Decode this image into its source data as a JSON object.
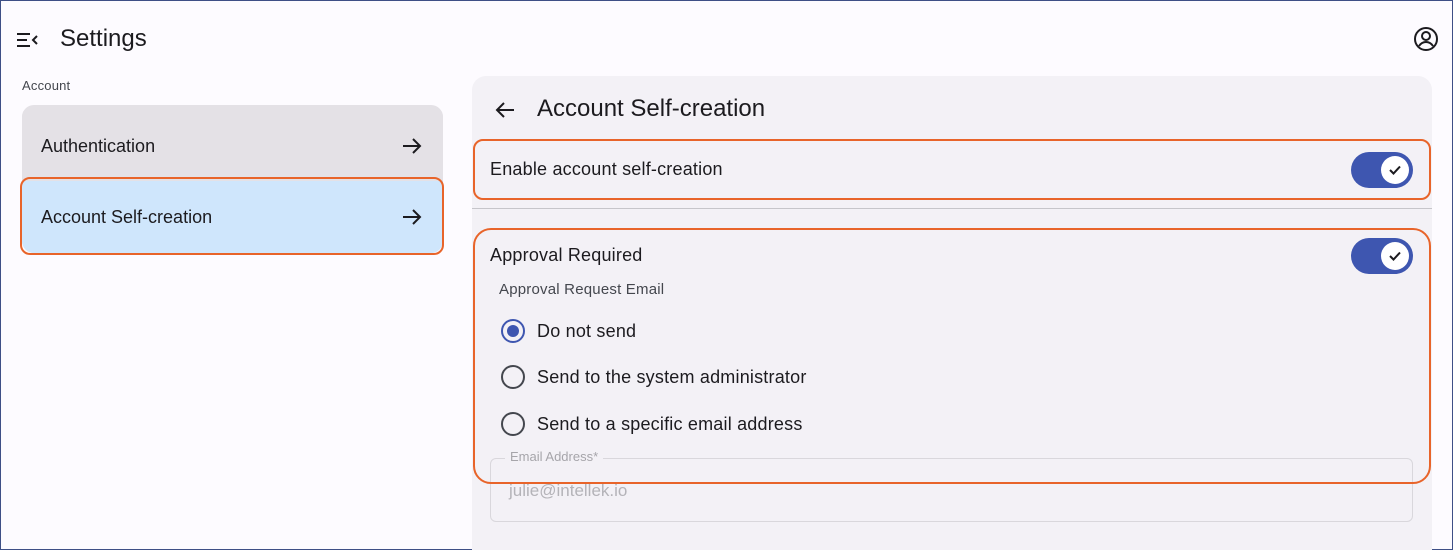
{
  "app": {
    "title": "Settings"
  },
  "sidebar": {
    "section_label": "Account",
    "items": [
      {
        "label": "Authentication",
        "selected": false
      },
      {
        "label": "Account Self-creation",
        "selected": true
      }
    ]
  },
  "panel": {
    "title": "Account Self-creation",
    "enable_self_creation": {
      "label": "Enable account self-creation",
      "checked": true
    },
    "approval_required": {
      "label": "Approval Required",
      "checked": true
    },
    "approval_email": {
      "label": "Approval Request Email",
      "options": [
        {
          "label": "Do not send",
          "checked": true
        },
        {
          "label": "Send to the system administrator",
          "checked": false
        },
        {
          "label": "Send to a specific email address",
          "checked": false
        }
      ]
    },
    "email_field": {
      "label": "Email Address*",
      "value": "julie@intellek.io"
    }
  },
  "colors": {
    "accent": "#3e56b0",
    "highlight": "#e8642a",
    "selected_bg": "#cfe6fc"
  },
  "icons": {
    "menu": "menu-collapse-icon",
    "account": "account-circle-icon",
    "back": "arrow-back-icon",
    "arrow": "arrow-forward-icon",
    "check": "check-icon"
  }
}
